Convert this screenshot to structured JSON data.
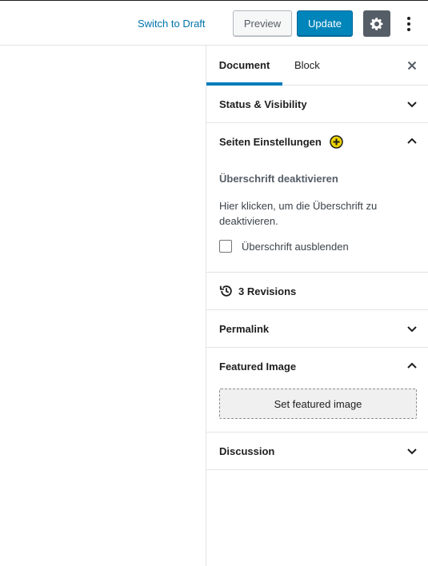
{
  "topbar": {
    "switch_to_draft": "Switch to Draft",
    "preview": "Preview",
    "update": "Update",
    "settings_icon": "gear-icon",
    "more_icon": "vertical-ellipsis-icon"
  },
  "sidebar": {
    "tabs": [
      {
        "label": "Document",
        "active": true
      },
      {
        "label": "Block",
        "active": false
      }
    ],
    "close_icon": "close-icon",
    "panels": {
      "status": {
        "title": "Status & Visibility",
        "expanded": false
      },
      "seiten": {
        "title": "Seiten Einstellungen",
        "expanded": true,
        "subheading": "Überschrift deaktivieren",
        "description": "Hier klicken, um die Überschrift zu deaktivieren.",
        "checkbox_label": "Überschrift ausblenden",
        "checkbox_checked": false
      },
      "revisions": {
        "title": "3 Revisions"
      },
      "permalink": {
        "title": "Permalink",
        "expanded": false
      },
      "featured": {
        "title": "Featured Image",
        "expanded": true,
        "button": "Set featured image"
      },
      "discussion": {
        "title": "Discussion",
        "expanded": false
      }
    }
  },
  "colors": {
    "accent": "#0085ba",
    "link": "#0073aa",
    "gear_bg": "#555d66",
    "plus_badge": "#f0d400"
  }
}
